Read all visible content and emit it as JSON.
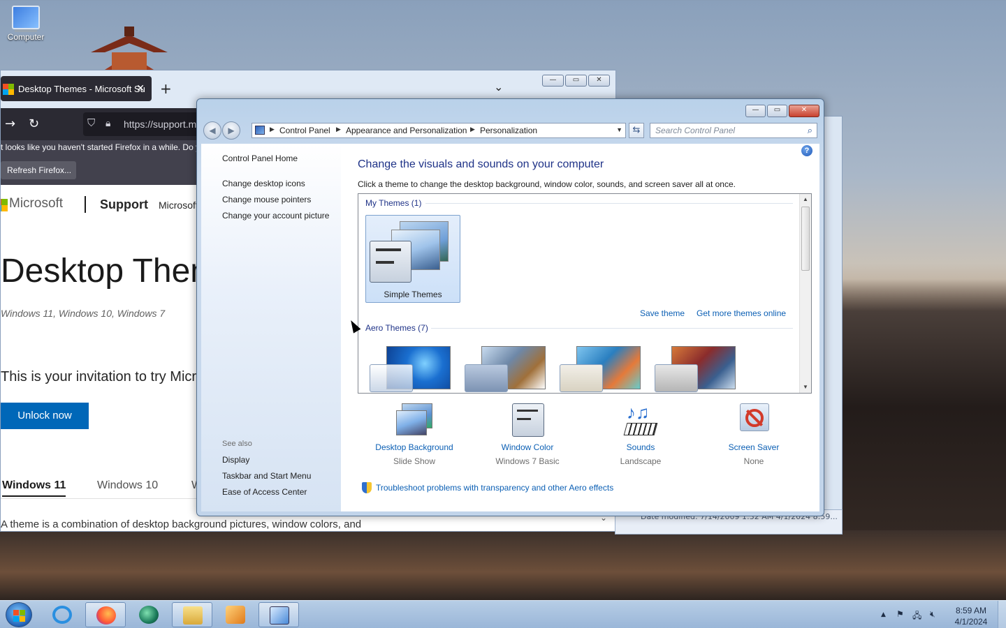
{
  "desktop": {
    "icons": [
      {
        "label": "Computer",
        "icon": "computer-icon"
      }
    ]
  },
  "firefox": {
    "tab_title": "Desktop Themes - Microsoft Su",
    "new_tab": "+",
    "url": "https://support.m",
    "notice_text": "t looks like you haven't started Firefox in a while. Do y",
    "notice_button": "Refresh Firefox...",
    "page": {
      "brand": "Microsoft",
      "support": "Support",
      "more": "Microsoft",
      "title": "Desktop Them",
      "applies_to": "Windows 11, Windows 10, Windows 7",
      "invitation": "This is your invitation to try Micr",
      "unlock_button": "Unlock now",
      "tabs": [
        "Windows 11",
        "Windows 10",
        "W"
      ],
      "paragraph": "A theme is a combination of desktop background pictures, window colors, and"
    }
  },
  "explorer_bg": {
    "status": "Date modified: 7/14/2009 1:32 AM    4/1/2024 8:59..."
  },
  "control_panel": {
    "breadcrumb": [
      "Control Panel",
      "Appearance and Personalization",
      "Personalization"
    ],
    "search_placeholder": "Search Control Panel",
    "help": "?",
    "sidebar": {
      "home": "Control Panel Home",
      "links": [
        "Change desktop icons",
        "Change mouse pointers",
        "Change your account picture"
      ],
      "see_also_label": "See also",
      "see_also": [
        "Display",
        "Taskbar and Start Menu",
        "Ease of Access Center"
      ]
    },
    "title": "Change the visuals and sounds on your computer",
    "description": "Click a theme to change the desktop background, window color, sounds, and screen saver all at once.",
    "my_themes_label": "My Themes (1)",
    "selected_theme": "Simple Themes",
    "save_theme": "Save theme",
    "get_more": "Get more themes online",
    "aero_label": "Aero Themes (7)",
    "options": [
      {
        "name": "Desktop Background",
        "value": "Slide Show",
        "icon": "desktop-background-icon"
      },
      {
        "name": "Window Color",
        "value": "Windows 7 Basic",
        "icon": "window-color-icon"
      },
      {
        "name": "Sounds",
        "value": "Landscape",
        "icon": "sounds-icon"
      },
      {
        "name": "Screen Saver",
        "value": "None",
        "icon": "screen-saver-icon"
      }
    ],
    "troubleshoot": "Troubleshoot problems with transparency and other Aero effects"
  },
  "taskbar": {
    "apps": [
      "internet-explorer-icon",
      "firefox-icon",
      "media-center-icon",
      "explorer-icon",
      "media-player-icon",
      "control-panel-icon"
    ],
    "time": "8:59 AM",
    "date": "4/1/2024"
  }
}
